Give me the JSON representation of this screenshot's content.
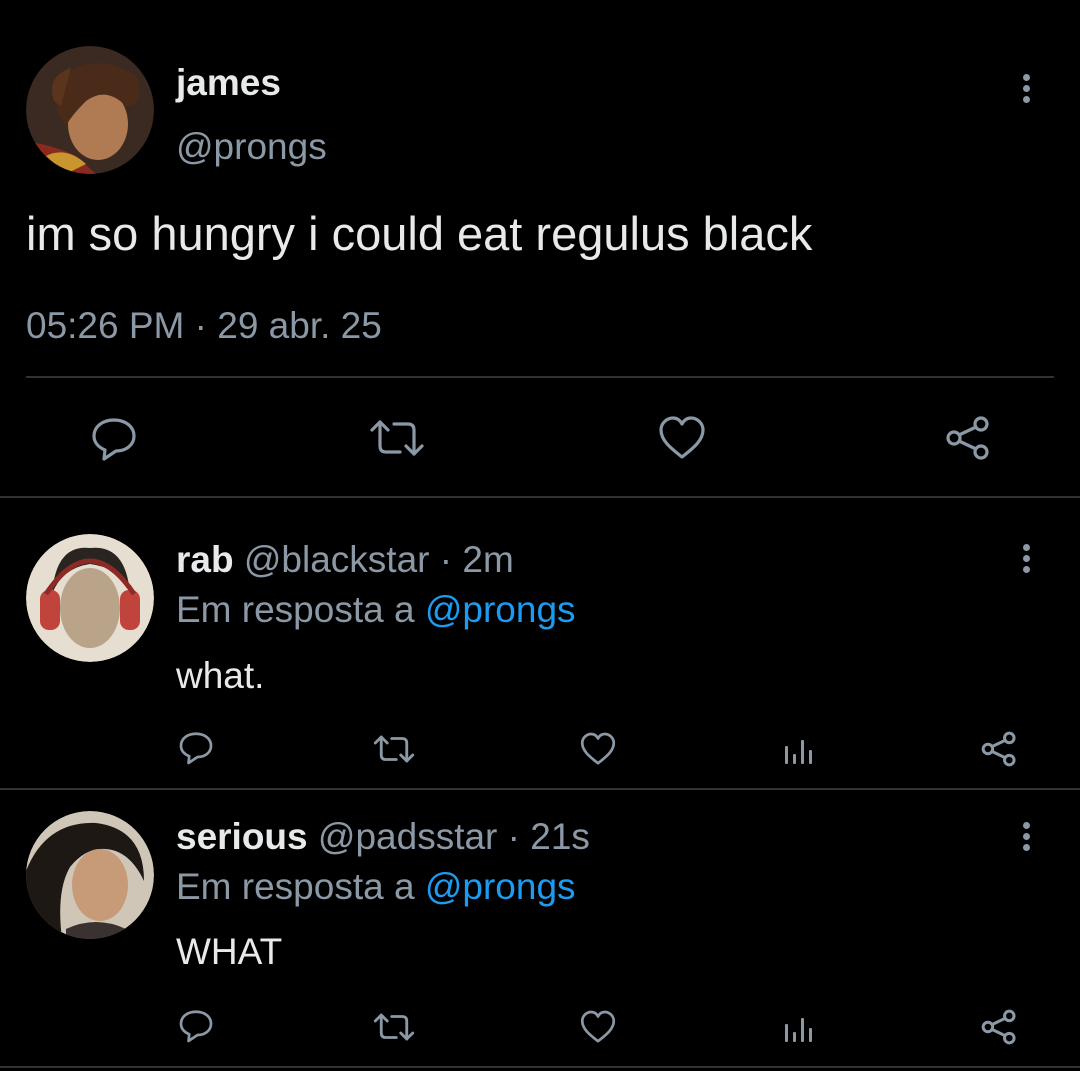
{
  "main_tweet": {
    "display_name": "james",
    "handle": "@prongs",
    "text": "im so hungry i could eat regulus black",
    "timestamp": "05:26 PM · 29 abr. 25"
  },
  "replies": [
    {
      "display_name": "rab",
      "handle": "@blackstar",
      "time": "· 2m",
      "reply_prefix": "Em resposta a",
      "reply_to": "@prongs",
      "text": "what."
    },
    {
      "display_name": "serious",
      "handle": "@padsstar",
      "time": "· 21s",
      "reply_prefix": "Em resposta a",
      "reply_to": "@prongs",
      "text": "WHAT"
    }
  ],
  "icons": {
    "reply": "reply-icon",
    "retweet": "retweet-icon",
    "like": "heart-icon",
    "views": "views-icon",
    "share": "share-icon",
    "more": "more-vertical-icon"
  },
  "colors": {
    "background": "#000000",
    "text": "#e7e9ea",
    "muted": "#8b98a5",
    "link": "#1d9bf0",
    "divider": "#2f3336"
  }
}
